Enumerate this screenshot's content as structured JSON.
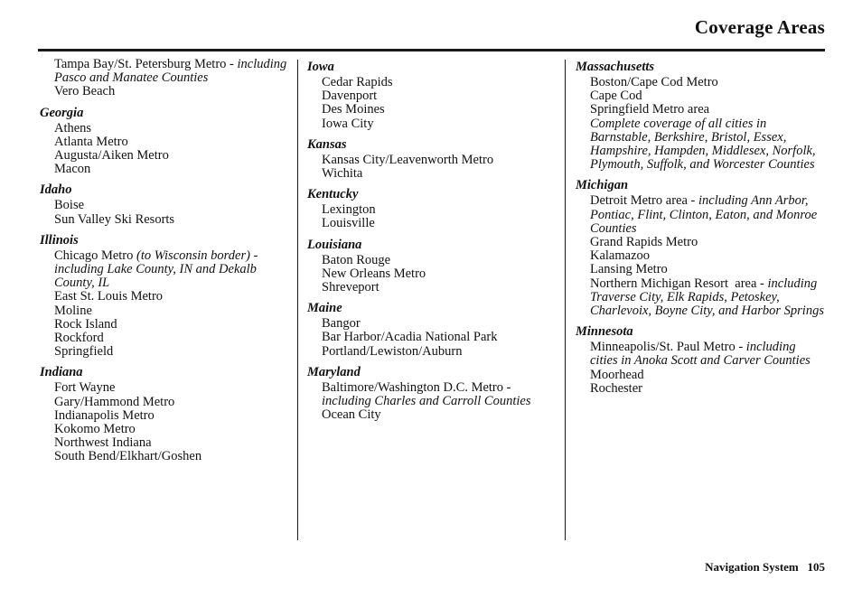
{
  "header": {
    "title": "Coverage Areas"
  },
  "footer": {
    "text": "Navigation System   105",
    "document_name": "Navigation System",
    "page_number": "105"
  },
  "columns": [
    {
      "id": "column-1",
      "blocks": [
        {
          "state": null,
          "continued": true,
          "cities": [
            {
              "segments": [
                {
                  "text": "Tampa Bay/St. Petersburg Metro - ",
                  "italic": false
                },
                {
                  "text": "including Pasco and Manatee Counties",
                  "italic": true
                }
              ]
            },
            {
              "segments": [
                {
                  "text": "Vero Beach",
                  "italic": false
                }
              ]
            }
          ]
        },
        {
          "state": "Georgia",
          "cities": [
            {
              "segments": [
                {
                  "text": "Athens",
                  "italic": false
                }
              ]
            },
            {
              "segments": [
                {
                  "text": "Atlanta Metro",
                  "italic": false
                }
              ]
            },
            {
              "segments": [
                {
                  "text": "Augusta/Aiken Metro",
                  "italic": false
                }
              ]
            },
            {
              "segments": [
                {
                  "text": "Macon",
                  "italic": false
                }
              ]
            }
          ]
        },
        {
          "state": "Idaho",
          "cities": [
            {
              "segments": [
                {
                  "text": "Boise",
                  "italic": false
                }
              ]
            },
            {
              "segments": [
                {
                  "text": "Sun Valley Ski Resorts",
                  "italic": false
                }
              ]
            }
          ]
        },
        {
          "state": "Illinois",
          "cities": [
            {
              "segments": [
                {
                  "text": "Chicago Metro ",
                  "italic": false
                },
                {
                  "text": "(to Wisconsin border) - including Lake County, IN and Dekalb County, IL",
                  "italic": true
                }
              ]
            },
            {
              "segments": [
                {
                  "text": "East St. Louis Metro",
                  "italic": false
                }
              ]
            },
            {
              "segments": [
                {
                  "text": "Moline",
                  "italic": false
                }
              ]
            },
            {
              "segments": [
                {
                  "text": "Rock Island",
                  "italic": false
                }
              ]
            },
            {
              "segments": [
                {
                  "text": "Rockford",
                  "italic": false
                }
              ]
            },
            {
              "segments": [
                {
                  "text": "Springfield",
                  "italic": false
                }
              ]
            }
          ]
        },
        {
          "state": "Indiana",
          "cities": [
            {
              "segments": [
                {
                  "text": "Fort Wayne",
                  "italic": false
                }
              ]
            },
            {
              "segments": [
                {
                  "text": "Gary/Hammond Metro",
                  "italic": false
                }
              ]
            },
            {
              "segments": [
                {
                  "text": "Indianapolis Metro",
                  "italic": false
                }
              ]
            },
            {
              "segments": [
                {
                  "text": "Kokomo Metro",
                  "italic": false
                }
              ]
            },
            {
              "segments": [
                {
                  "text": "Northwest Indiana",
                  "italic": false
                }
              ]
            },
            {
              "segments": [
                {
                  "text": "South Bend/Elkhart/Goshen",
                  "italic": false
                }
              ]
            }
          ]
        }
      ]
    },
    {
      "id": "column-2",
      "blocks": [
        {
          "state": "Iowa",
          "cities": [
            {
              "segments": [
                {
                  "text": "Cedar Rapids",
                  "italic": false
                }
              ]
            },
            {
              "segments": [
                {
                  "text": "Davenport",
                  "italic": false
                }
              ]
            },
            {
              "segments": [
                {
                  "text": "Des Moines",
                  "italic": false
                }
              ]
            },
            {
              "segments": [
                {
                  "text": "Iowa City",
                  "italic": false
                }
              ]
            }
          ]
        },
        {
          "state": "Kansas",
          "cities": [
            {
              "segments": [
                {
                  "text": "Kansas City/Leavenworth Metro",
                  "italic": false
                }
              ]
            },
            {
              "segments": [
                {
                  "text": "Wichita",
                  "italic": false
                }
              ]
            }
          ]
        },
        {
          "state": "Kentucky",
          "cities": [
            {
              "segments": [
                {
                  "text": "Lexington",
                  "italic": false
                }
              ]
            },
            {
              "segments": [
                {
                  "text": "Louisville",
                  "italic": false
                }
              ]
            }
          ]
        },
        {
          "state": "Louisiana",
          "cities": [
            {
              "segments": [
                {
                  "text": "Baton Rouge",
                  "italic": false
                }
              ]
            },
            {
              "segments": [
                {
                  "text": "New Orleans Metro",
                  "italic": false
                }
              ]
            },
            {
              "segments": [
                {
                  "text": "Shreveport",
                  "italic": false
                }
              ]
            }
          ]
        },
        {
          "state": "Maine",
          "cities": [
            {
              "segments": [
                {
                  "text": "Bangor",
                  "italic": false
                }
              ]
            },
            {
              "segments": [
                {
                  "text": "Bar Harbor/Acadia National Park",
                  "italic": false
                }
              ]
            },
            {
              "segments": [
                {
                  "text": "Portland/Lewiston/Auburn",
                  "italic": false
                }
              ]
            }
          ]
        },
        {
          "state": "Maryland",
          "cities": [
            {
              "segments": [
                {
                  "text": "Baltimore/Washington D.C. Metro - ",
                  "italic": false
                },
                {
                  "text": "including Charles and Carroll Counties",
                  "italic": true
                }
              ]
            },
            {
              "segments": [
                {
                  "text": "Ocean City",
                  "italic": false
                }
              ]
            }
          ]
        }
      ]
    },
    {
      "id": "column-3",
      "blocks": [
        {
          "state": "Massachusetts",
          "cities": [
            {
              "segments": [
                {
                  "text": "Boston/Cape Cod Metro",
                  "italic": false
                }
              ]
            },
            {
              "segments": [
                {
                  "text": "Cape Cod",
                  "italic": false
                }
              ]
            },
            {
              "segments": [
                {
                  "text": "Springfield Metro area",
                  "italic": false
                }
              ]
            },
            {
              "segments": [
                {
                  "text": "Complete coverage of all cities in Barnstable, Berkshire, Bristol, Essex, Hampshire, Hampden, Middlesex, Norfolk, Plymouth, Suffolk, and Worcester Counties",
                  "italic": true
                }
              ]
            }
          ]
        },
        {
          "state": "Michigan",
          "cities": [
            {
              "segments": [
                {
                  "text": "Detroit Metro area - ",
                  "italic": false
                },
                {
                  "text": "including Ann Arbor, Pontiac, Flint, Clinton, Eaton, and Monroe Counties",
                  "italic": true
                }
              ]
            },
            {
              "segments": [
                {
                  "text": "Grand Rapids Metro",
                  "italic": false
                }
              ]
            },
            {
              "segments": [
                {
                  "text": "Kalamazoo",
                  "italic": false
                }
              ]
            },
            {
              "segments": [
                {
                  "text": "Lansing Metro",
                  "italic": false
                }
              ]
            },
            {
              "segments": [
                {
                  "text": "Northern Michigan Resort  area - ",
                  "italic": false
                },
                {
                  "text": "including Traverse City, Elk Rapids, Petoskey, Charlevoix, Boyne City, and Harbor Springs",
                  "italic": true
                }
              ]
            }
          ]
        },
        {
          "state": "Minnesota",
          "cities": [
            {
              "segments": [
                {
                  "text": "Minneapolis/St. Paul Metro - ",
                  "italic": false
                },
                {
                  "text": "including cities in Anoka Scott and Carver Counties",
                  "italic": true
                }
              ]
            },
            {
              "segments": [
                {
                  "text": "Moorhead",
                  "italic": false
                }
              ]
            },
            {
              "segments": [
                {
                  "text": "Rochester",
                  "italic": false
                }
              ]
            }
          ]
        }
      ]
    }
  ]
}
